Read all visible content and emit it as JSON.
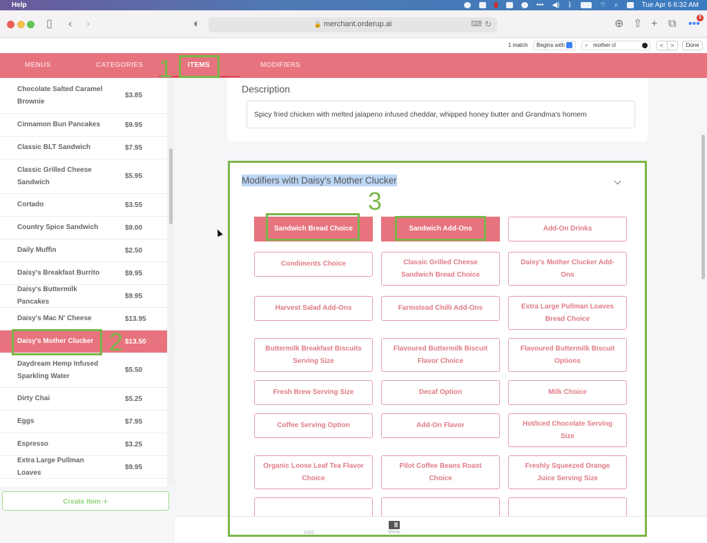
{
  "menubar": {
    "app_menu_last": "Help",
    "clock": "Tue Apr 6  6:32 AM"
  },
  "browser": {
    "url": "merchant.orderup.ai",
    "notification_count": "2",
    "find": {
      "match_count": "1 match",
      "mode": "Begins with",
      "query": "mother cl",
      "prev": "<",
      "next": ">",
      "done_label": "Done"
    }
  },
  "nav": {
    "tabs": [
      {
        "label": "MENUS",
        "active": false
      },
      {
        "label": "CATEGORIES",
        "active": false
      },
      {
        "label": "ITEMS",
        "active": true
      },
      {
        "label": "MODIFIERS",
        "active": false
      }
    ]
  },
  "annotations": [
    "1",
    "2",
    "3"
  ],
  "items": [
    {
      "name": "Chocolate Salted Caramel Brownie",
      "price": "$3.85"
    },
    {
      "name": "Cinnamon Bun Pancakes",
      "price": "$9.95"
    },
    {
      "name": "Classic BLT Sandwich",
      "price": "$7.95"
    },
    {
      "name": "Classic Grilled Cheese Sandwich",
      "price": "$5.95"
    },
    {
      "name": "Cortado",
      "price": "$3.55"
    },
    {
      "name": "Country Spice Sandwich",
      "price": "$9.00"
    },
    {
      "name": "Daily Muffin",
      "price": "$2.50"
    },
    {
      "name": "Daisy's Breakfast Burrito",
      "price": "$9.95"
    },
    {
      "name": "Daisy's Buttermilk Pancakes",
      "price": "$9.95"
    },
    {
      "name": "Daisy's Mac N' Cheese",
      "price": "$13.95"
    },
    {
      "name": "Daisy's Mother Clucker",
      "price": "$13.50",
      "selected": true
    },
    {
      "name": "Daydream Hemp Infused Sparkling Water",
      "price": "$5.50"
    },
    {
      "name": "Dirty Chai",
      "price": "$5.25"
    },
    {
      "name": "Eggs",
      "price": "$7.95"
    },
    {
      "name": "Espresso",
      "price": "$3.25"
    },
    {
      "name": "Extra Large Pullman Loaves",
      "price": "$9.95"
    }
  ],
  "create_item": {
    "label": "Create Item",
    "icon": "+"
  },
  "detail": {
    "description_label": "Description",
    "description_value": "Spicy fried chicken with melted jalapeno infused cheddar, whipped honey butter and Grandma's homem",
    "modifiers_title": "Modifiers with Daisy's Mother Clucker",
    "modifiers": [
      {
        "label": "Sandwich Bread Choice",
        "selected": true
      },
      {
        "label": "Sandwich Add-Ons",
        "selected": true
      },
      {
        "label": "Add-On Drinks",
        "selected": false
      },
      {
        "label": "Condiments Choice",
        "selected": false
      },
      {
        "label": "Classic Grilled Cheese Sandwich Bread Choice",
        "selected": false
      },
      {
        "label": "Daisy's Mother Clucker Add-Ons",
        "selected": false
      },
      {
        "label": "Harvest Salad Add-Ons",
        "selected": false
      },
      {
        "label": "Farmstead Chilli Add-Ons",
        "selected": false
      },
      {
        "label": "Extra Large Pullman Loaves Bread Choice",
        "selected": false
      },
      {
        "label": "Buttermilk Breakfast Biscuits Serving Size",
        "selected": false
      },
      {
        "label": "Flavoured Buttermilk Biscuit Flavor Choice",
        "selected": false
      },
      {
        "label": "Flavoured Buttermilk Biscuit Options",
        "selected": false
      },
      {
        "label": "Fresh Brew Serving Size",
        "selected": false
      },
      {
        "label": "Decaf Option",
        "selected": false
      },
      {
        "label": "Milk Choice",
        "selected": false
      },
      {
        "label": "Coffee Serving Option",
        "selected": false
      },
      {
        "label": "Add-On Flavor",
        "selected": false
      },
      {
        "label": "Hot/Iced Chocolate Serving Size",
        "selected": false
      },
      {
        "label": "Organic Loose Leaf Tea Flavor Choice",
        "selected": false
      },
      {
        "label": "Pilot Coffee Beans Roast Choice",
        "selected": false
      },
      {
        "label": "Freshly Squeezed Orange Juice Serving Size",
        "selected": false
      },
      {
        "label": "",
        "selected": false
      },
      {
        "label": "",
        "selected": false
      },
      {
        "label": "",
        "selected": false
      }
    ]
  },
  "bottom_nav": [
    {
      "label": "KDS",
      "icon": "kds-grid-icon"
    },
    {
      "label": "Menu",
      "icon": "book-icon"
    }
  ],
  "colors": {
    "brand": "#e7737e",
    "annotation": "#7ab648",
    "create_button": "#8fd47b"
  }
}
